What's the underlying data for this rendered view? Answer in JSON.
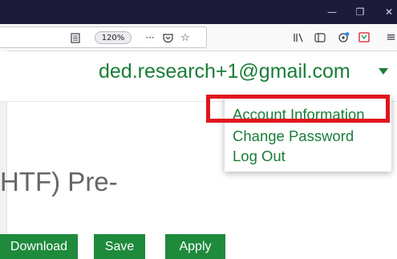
{
  "browser": {
    "window_controls": {
      "minimize": "—",
      "restore": "❐",
      "close": "✕"
    },
    "urlbar": {
      "reader_icon": "reader-view-icon",
      "zoom_level": "120%",
      "page_actions_icon": "···",
      "pocket_icon": "pocket-icon",
      "bookmark_icon": "☆"
    },
    "toolbar": {
      "library_icon": "library-icon",
      "sidebar_icon": "sidebar-icon",
      "extension_icon": "extension-icon",
      "addon_icon": "addon-icon",
      "menu_icon": "≡"
    }
  },
  "header": {
    "user_email": "ded.research+1@gmail.com"
  },
  "account_menu": {
    "items": [
      {
        "label": "Account Information"
      },
      {
        "label": "Change Password"
      },
      {
        "label": "Log Out"
      }
    ],
    "highlight_color": "#e0151e"
  },
  "main": {
    "title_fragment": "HTF) Pre-"
  },
  "actions": {
    "download_label": "Download",
    "save_label": "Save",
    "apply_label": "Apply"
  },
  "colors": {
    "brand_green": "#1a7d39",
    "button_green": "#1e8a3c",
    "titlebar": "#1c1b3a"
  }
}
